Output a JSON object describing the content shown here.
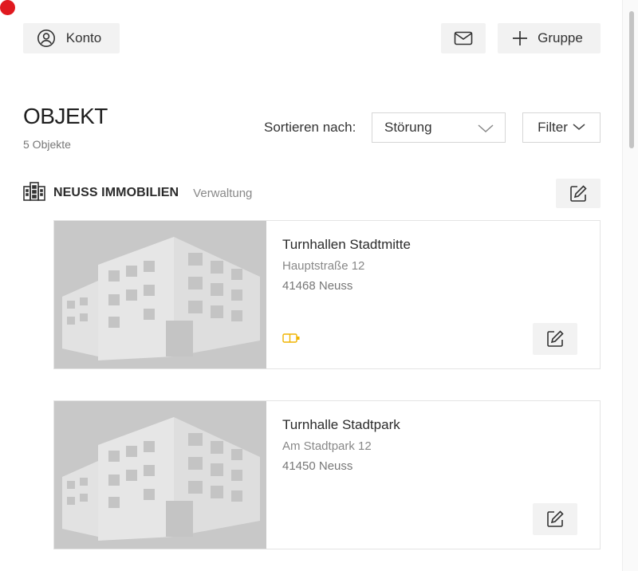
{
  "header": {
    "account_label": "Konto",
    "group_button_label": "Gruppe",
    "mail_icon": "mail-icon",
    "account_icon": "user-circle-icon",
    "plus_icon": "plus-icon"
  },
  "section": {
    "title": "OBJEKT",
    "count_text": "5 Objekte"
  },
  "sort": {
    "label": "Sortieren nach:",
    "selected": "Störung",
    "filter_label": "Filter"
  },
  "group": {
    "icon": "building-icon",
    "name": "NEUSS IMMOBILIEN",
    "role": "Verwaltung"
  },
  "objects": [
    {
      "name": "Turnhallen Stadtmitte",
      "street": "Hauptstraße 12",
      "city": "41468 Neuss",
      "status_icon": "battery-icon",
      "status_color": "#f0b400"
    },
    {
      "name": "Turnhalle Stadtpark",
      "street": "Am Stadtpark 12",
      "city": "41450 Neuss"
    }
  ],
  "colors": {
    "accent_dot": "#e0191f",
    "image_placeholder": "#c8c8c8",
    "button_bg": "#f2f2f2"
  }
}
